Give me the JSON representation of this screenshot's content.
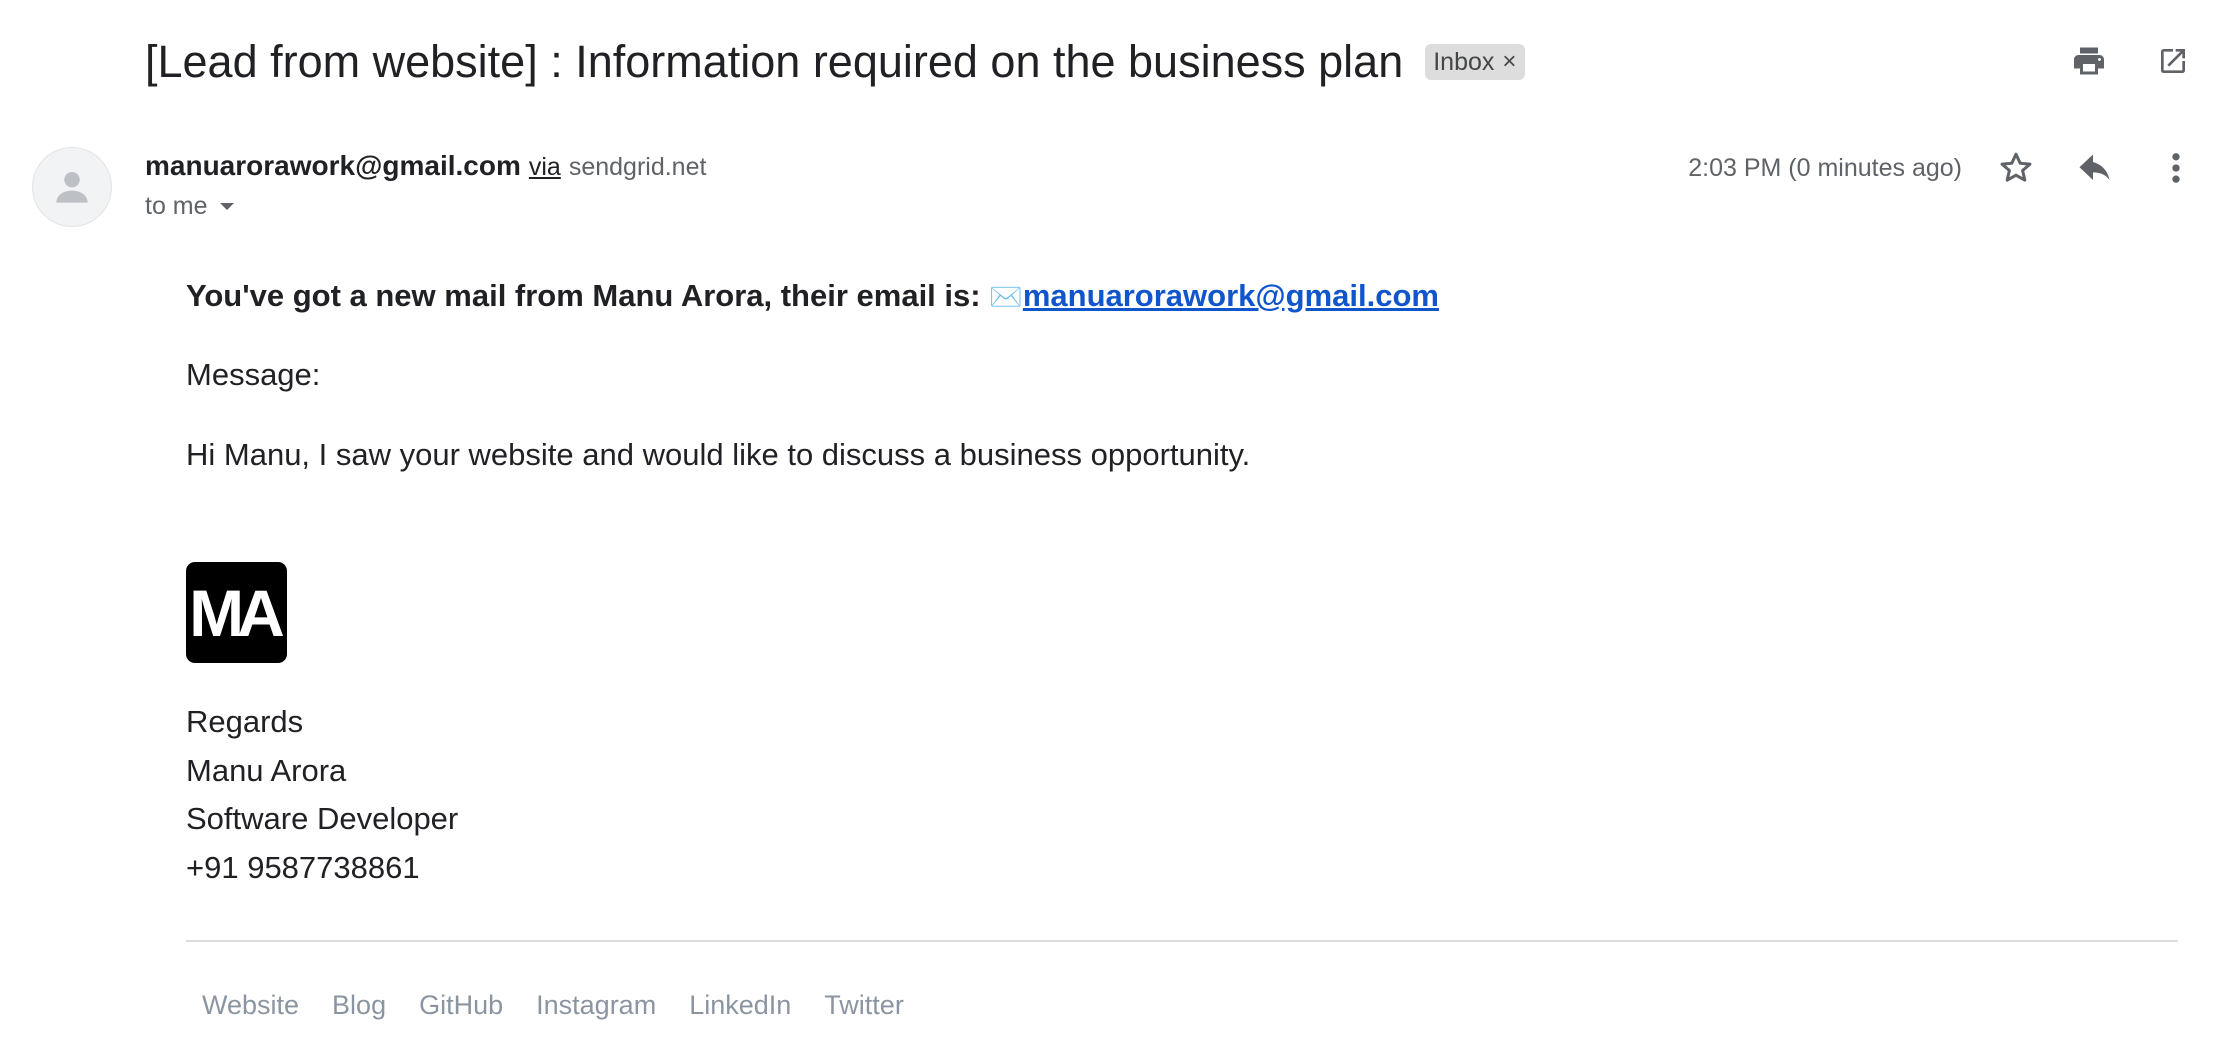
{
  "email": {
    "subject": "[Lead from website] : Information required on the business plan",
    "label": "Inbox",
    "label_remove_glyph": "×",
    "sender_email": "manuarorawork@gmail.com",
    "via_text": "via",
    "via_domain": "sendgrid.net",
    "recipient_text": "to me",
    "timestamp": "2:03 PM (0 minutes ago)"
  },
  "icons": {
    "print": "print-icon",
    "open_new_window": "open-in-new-window-icon",
    "avatar": "default-avatar-icon",
    "star": "star-icon",
    "reply": "reply-icon",
    "more": "more-vertical-icon",
    "recipient_details": "caret-down-icon"
  },
  "body": {
    "intro_text": "You've got a new mail from Manu Arora, their email is: ",
    "envelope_glyph": "✉️",
    "contact_email": "manuarorawork@gmail.com",
    "message_label": "Message:",
    "message_text": "Hi Manu, I saw your website and would like to discuss a business opportunity.",
    "logo_text": "MA",
    "signature": [
      "Regards",
      "Manu Arora",
      "Software Developer",
      "+91 9587738861"
    ]
  },
  "footer": {
    "links": [
      "Website",
      "Blog",
      "GitHub",
      "Instagram",
      "LinkedIn",
      "Twitter"
    ]
  },
  "colors": {
    "link": "#1155cc",
    "footer_link": "#8b95a1",
    "label_chip_bg": "#dddddd",
    "icon_gray": "#5f6368"
  }
}
